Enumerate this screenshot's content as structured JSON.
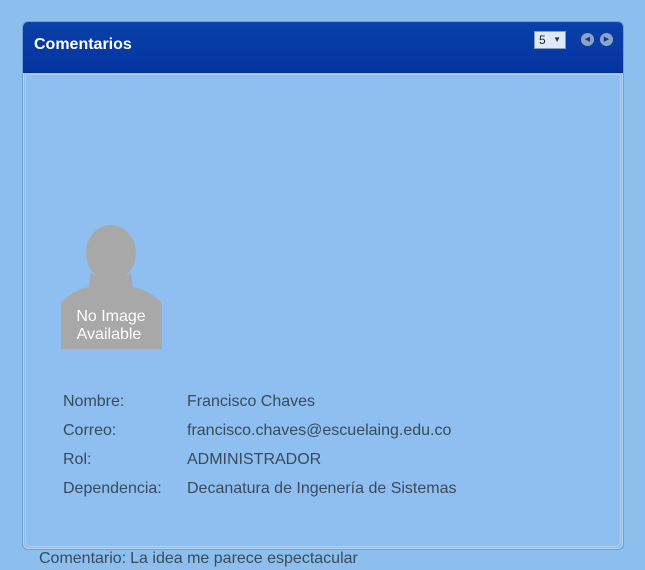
{
  "panel": {
    "title": "Comentarios",
    "page_size": "5",
    "prev_icon": "prev-arrow-icon",
    "next_icon": "next-arrow-icon"
  },
  "avatar": {
    "line1": "No Image",
    "line2": "Available"
  },
  "user": {
    "name_label": "Nombre:",
    "name_value": "Francisco Chaves",
    "email_label": "Correo:",
    "email_value": "francisco.chaves@escuelaing.edu.co",
    "role_label": "Rol:",
    "role_value": "ADMINISTRADOR",
    "dept_label": "Dependencia:",
    "dept_value": "Decanatura de Ingenería de Sistemas"
  },
  "comment": {
    "label": "Comentario:",
    "text": "La idea me parece espectacular"
  },
  "colors": {
    "header": "#0534a0",
    "panel": "#8ebff0",
    "text": "#3a4a5a"
  }
}
